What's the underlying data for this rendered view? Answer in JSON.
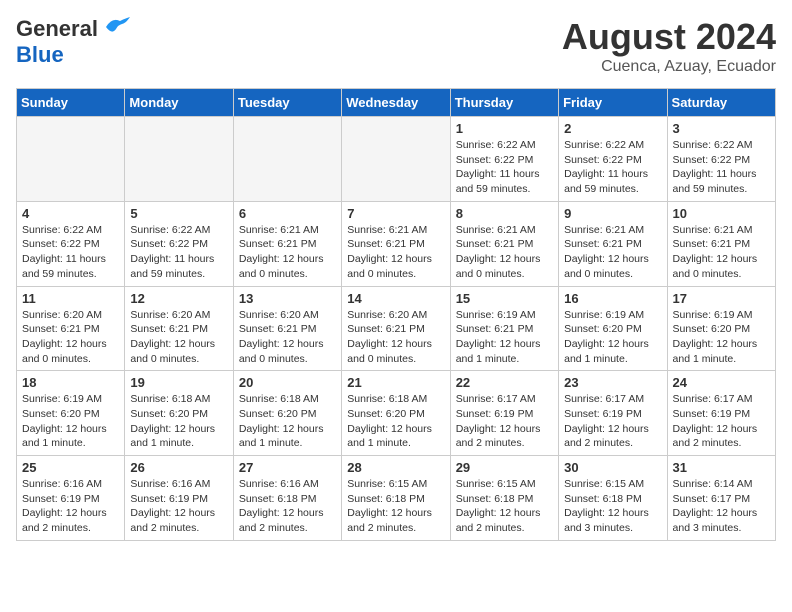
{
  "header": {
    "logo_general": "General",
    "logo_blue": "Blue",
    "title": "August 2024",
    "subtitle": "Cuenca, Azuay, Ecuador"
  },
  "weekdays": [
    "Sunday",
    "Monday",
    "Tuesday",
    "Wednesday",
    "Thursday",
    "Friday",
    "Saturday"
  ],
  "weeks": [
    [
      {
        "day": "",
        "empty": true
      },
      {
        "day": "",
        "empty": true
      },
      {
        "day": "",
        "empty": true
      },
      {
        "day": "",
        "empty": true
      },
      {
        "day": "1",
        "sunrise": "6:22 AM",
        "sunset": "6:22 PM",
        "daylight": "11 hours and 59 minutes."
      },
      {
        "day": "2",
        "sunrise": "6:22 AM",
        "sunset": "6:22 PM",
        "daylight": "11 hours and 59 minutes."
      },
      {
        "day": "3",
        "sunrise": "6:22 AM",
        "sunset": "6:22 PM",
        "daylight": "11 hours and 59 minutes."
      }
    ],
    [
      {
        "day": "4",
        "sunrise": "6:22 AM",
        "sunset": "6:22 PM",
        "daylight": "11 hours and 59 minutes."
      },
      {
        "day": "5",
        "sunrise": "6:22 AM",
        "sunset": "6:22 PM",
        "daylight": "11 hours and 59 minutes."
      },
      {
        "day": "6",
        "sunrise": "6:21 AM",
        "sunset": "6:21 PM",
        "daylight": "12 hours and 0 minutes."
      },
      {
        "day": "7",
        "sunrise": "6:21 AM",
        "sunset": "6:21 PM",
        "daylight": "12 hours and 0 minutes."
      },
      {
        "day": "8",
        "sunrise": "6:21 AM",
        "sunset": "6:21 PM",
        "daylight": "12 hours and 0 minutes."
      },
      {
        "day": "9",
        "sunrise": "6:21 AM",
        "sunset": "6:21 PM",
        "daylight": "12 hours and 0 minutes."
      },
      {
        "day": "10",
        "sunrise": "6:21 AM",
        "sunset": "6:21 PM",
        "daylight": "12 hours and 0 minutes."
      }
    ],
    [
      {
        "day": "11",
        "sunrise": "6:20 AM",
        "sunset": "6:21 PM",
        "daylight": "12 hours and 0 minutes."
      },
      {
        "day": "12",
        "sunrise": "6:20 AM",
        "sunset": "6:21 PM",
        "daylight": "12 hours and 0 minutes."
      },
      {
        "day": "13",
        "sunrise": "6:20 AM",
        "sunset": "6:21 PM",
        "daylight": "12 hours and 0 minutes."
      },
      {
        "day": "14",
        "sunrise": "6:20 AM",
        "sunset": "6:21 PM",
        "daylight": "12 hours and 0 minutes."
      },
      {
        "day": "15",
        "sunrise": "6:19 AM",
        "sunset": "6:21 PM",
        "daylight": "12 hours and 1 minute."
      },
      {
        "day": "16",
        "sunrise": "6:19 AM",
        "sunset": "6:20 PM",
        "daylight": "12 hours and 1 minute."
      },
      {
        "day": "17",
        "sunrise": "6:19 AM",
        "sunset": "6:20 PM",
        "daylight": "12 hours and 1 minute."
      }
    ],
    [
      {
        "day": "18",
        "sunrise": "6:19 AM",
        "sunset": "6:20 PM",
        "daylight": "12 hours and 1 minute."
      },
      {
        "day": "19",
        "sunrise": "6:18 AM",
        "sunset": "6:20 PM",
        "daylight": "12 hours and 1 minute."
      },
      {
        "day": "20",
        "sunrise": "6:18 AM",
        "sunset": "6:20 PM",
        "daylight": "12 hours and 1 minute."
      },
      {
        "day": "21",
        "sunrise": "6:18 AM",
        "sunset": "6:20 PM",
        "daylight": "12 hours and 1 minute."
      },
      {
        "day": "22",
        "sunrise": "6:17 AM",
        "sunset": "6:19 PM",
        "daylight": "12 hours and 2 minutes."
      },
      {
        "day": "23",
        "sunrise": "6:17 AM",
        "sunset": "6:19 PM",
        "daylight": "12 hours and 2 minutes."
      },
      {
        "day": "24",
        "sunrise": "6:17 AM",
        "sunset": "6:19 PM",
        "daylight": "12 hours and 2 minutes."
      }
    ],
    [
      {
        "day": "25",
        "sunrise": "6:16 AM",
        "sunset": "6:19 PM",
        "daylight": "12 hours and 2 minutes."
      },
      {
        "day": "26",
        "sunrise": "6:16 AM",
        "sunset": "6:19 PM",
        "daylight": "12 hours and 2 minutes."
      },
      {
        "day": "27",
        "sunrise": "6:16 AM",
        "sunset": "6:18 PM",
        "daylight": "12 hours and 2 minutes."
      },
      {
        "day": "28",
        "sunrise": "6:15 AM",
        "sunset": "6:18 PM",
        "daylight": "12 hours and 2 minutes."
      },
      {
        "day": "29",
        "sunrise": "6:15 AM",
        "sunset": "6:18 PM",
        "daylight": "12 hours and 2 minutes."
      },
      {
        "day": "30",
        "sunrise": "6:15 AM",
        "sunset": "6:18 PM",
        "daylight": "12 hours and 3 minutes."
      },
      {
        "day": "31",
        "sunrise": "6:14 AM",
        "sunset": "6:17 PM",
        "daylight": "12 hours and 3 minutes."
      }
    ]
  ],
  "labels": {
    "sunrise": "Sunrise:",
    "sunset": "Sunset:",
    "daylight": "Daylight:"
  }
}
